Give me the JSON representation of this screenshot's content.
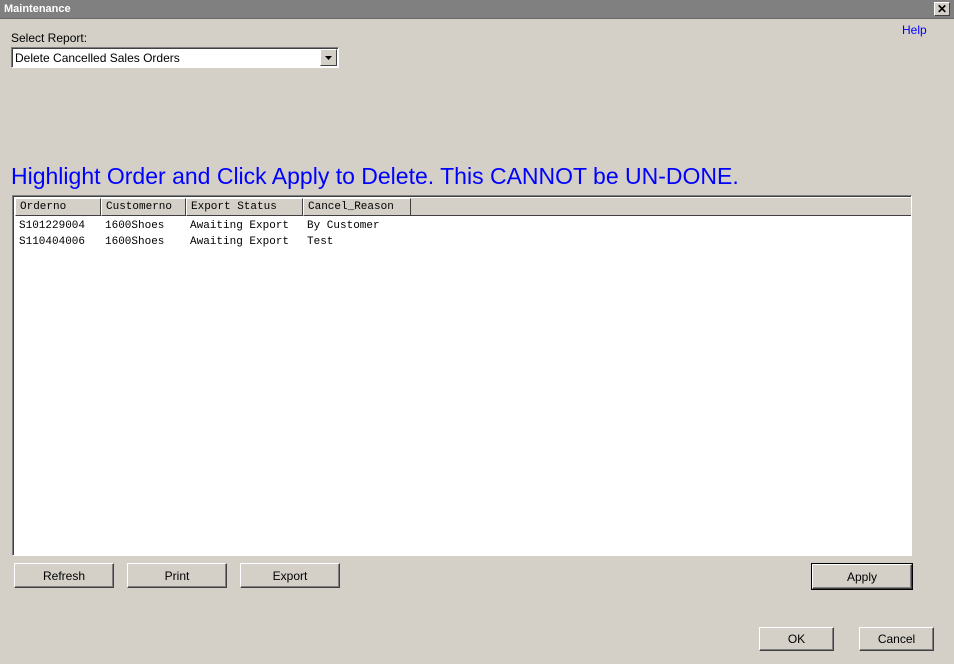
{
  "window": {
    "title": "Maintenance",
    "close_symbol": "✕"
  },
  "help_label": "Help",
  "report": {
    "label": "Select Report:",
    "selected": "Delete Cancelled Sales Orders",
    "dropdown_icon": "chevron-down-icon"
  },
  "instruction": "Highlight Order and Click Apply to Delete.  This CANNOT be UN-DONE.",
  "table": {
    "columns": [
      "Orderno",
      "Customerno",
      "Export Status",
      "Cancel_Reason"
    ],
    "rows": [
      [
        "S101229004",
        "1600Shoes",
        "Awaiting Export",
        "By Customer"
      ],
      [
        "S110404006",
        "1600Shoes",
        "Awaiting Export",
        "Test"
      ]
    ]
  },
  "buttons": {
    "refresh": "Refresh",
    "print": "Print",
    "export": "Export",
    "apply": "Apply",
    "ok": "OK",
    "cancel": "Cancel"
  },
  "colors": {
    "background": "#d4d0c8",
    "titlebar": "#808080",
    "link": "#0000ff",
    "instruction": "#0000ff"
  }
}
